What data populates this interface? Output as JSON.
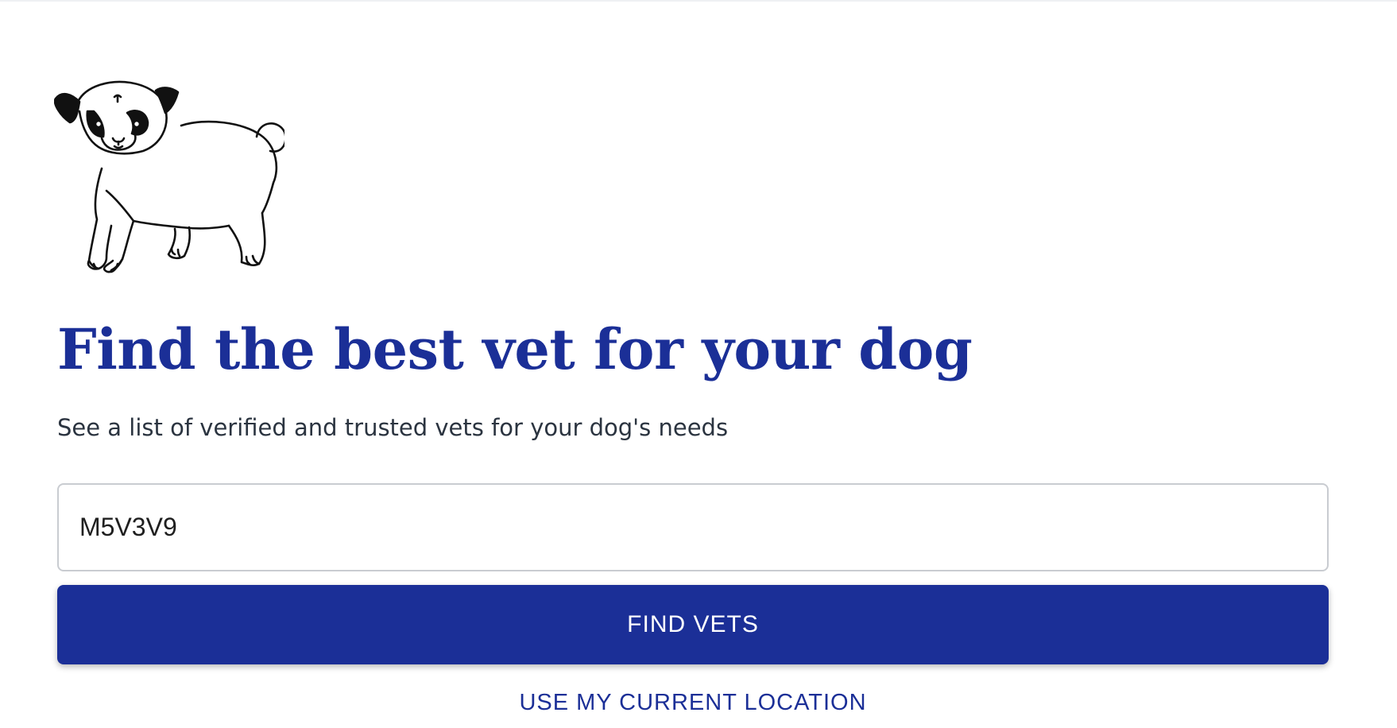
{
  "illustration": {
    "icon": "pug-dog-illustration"
  },
  "hero": {
    "title": "Find the best vet for your dog",
    "subtitle": "See a list of verified and trusted vets for your dog's needs"
  },
  "search": {
    "value": "M5V3V9",
    "button_label": "FIND VETS",
    "location_link": "USE MY CURRENT LOCATION"
  },
  "colors": {
    "brand": "#1b2f97",
    "text": "#2b3440",
    "border": "#c9ccd1"
  }
}
